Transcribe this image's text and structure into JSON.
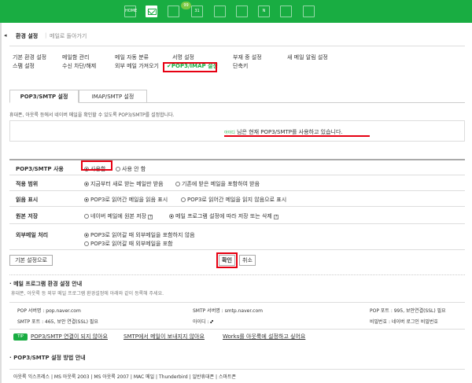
{
  "topbar": {
    "accent_color": "#19ad42",
    "icons": [
      "home-icon",
      "mail-icon",
      "note-icon",
      "calendar-icon",
      "doc-icon",
      "contact-icon",
      "cafe-icon",
      "more-icon"
    ],
    "badge": "99",
    "calendar_label": "31",
    "home_label": "HOME",
    "note_label": "N"
  },
  "header": {
    "title": "환경 설정",
    "back_link": "메일로 돌아가기"
  },
  "menu": {
    "col1": [
      "기본 환경 설정",
      "스팸 설정"
    ],
    "col2": [
      "메일함 관리",
      "수신 차단/해제"
    ],
    "col3": [
      "메일 자동 분류",
      "외부 메일 가져오기"
    ],
    "col4": [
      "서명 설정",
      "✔POP3/IMAP 설정"
    ],
    "col5": [
      "부재 중 설정",
      "단축키"
    ],
    "col6": [
      "새 메일 알림 설정"
    ]
  },
  "tabs": [
    "POP3/SMTP 설정",
    "IMAP/SMTP 설정"
  ],
  "description": "휴대폰, 아웃룩 등에서 네이버 메일을 확인할 수 있도록 POP3/SMTP를 설정합니다.",
  "notice": {
    "user_id": "아이디",
    "text": "님은 현재 POP3/SMTP를 사용하고 있습니다."
  },
  "settings": {
    "pop3_use": {
      "label": "POP3/SMTP 사용",
      "option_on": "사용함",
      "option_off": "사용 안 함"
    },
    "scope": {
      "label": "적용 범위",
      "option1": "지금부터 새로 받는 메일만 받음",
      "option2": "기존에 받은 메일을 포함하여 받음"
    },
    "read": {
      "label": "읽음 표시",
      "option1": "POP3로 읽어간 메일을 읽음 표시",
      "option2": "POP3로 읽어간 메일을 읽지 않음으로 표시"
    },
    "original": {
      "label": "원본 저장",
      "option1": "네이버 메일에 원본 저장",
      "option2": "메일 프로그램 설정에 따라 저장 또는 삭제"
    },
    "external": {
      "label": "외부메일 처리",
      "option1": "POP3로 읽어갈 때 외부메일을 포함하지 않음",
      "option2": "POP3로 읽어갈 때 외부메일을 포함"
    }
  },
  "buttons": {
    "default": "기본 설정으로",
    "confirm": "확인",
    "cancel": "취소"
  },
  "guide": {
    "title": "메일 프로그램 환경 설정 안내",
    "subtitle": "휴대폰, 아웃룩 등 외부 메일 프로그램 환경설정에 아래와 같이 등록해 주세요.",
    "pop_server": "POP 서버명 : pop.naver.com",
    "smtp_server": "SMTP 서버명 : smtp.naver.com",
    "pop_port": "POP 포트 : 995, 보안연결(SSL) 필요",
    "smtp_port": "SMTP 포트 : 465, 보안 연결(SSL) 필요",
    "user_id": "아이디 : 🙾",
    "password": "비밀번호 : 네이버 로그인 비밀번호"
  },
  "tip": {
    "badge": "TIP",
    "link1": "POP3/SMTP 연결이 되지 않아요",
    "link2": "SMTP에서 메일이 보내지지 않아요",
    "link3": "Works를 아웃룩에 설정하고 싶어요"
  },
  "method": {
    "title": "POP3/SMTP 설정 방법 안내",
    "clients": "아웃룩 익스프레스 | MS 아웃룩 2003 | MS 아웃룩 2007 | MAC 메일 | Thunderbird | 일반휴대폰 | 스마트폰"
  }
}
